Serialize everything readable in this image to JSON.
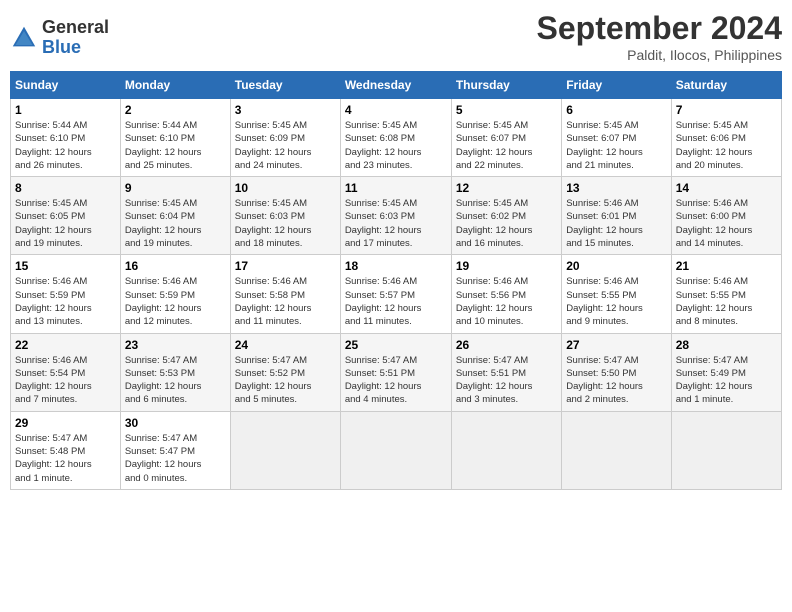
{
  "logo": {
    "general": "General",
    "blue": "Blue"
  },
  "title": {
    "month_year": "September 2024",
    "location": "Paldit, Ilocos, Philippines"
  },
  "weekdays": [
    "Sunday",
    "Monday",
    "Tuesday",
    "Wednesday",
    "Thursday",
    "Friday",
    "Saturday"
  ],
  "weeks": [
    [
      {
        "day": "1",
        "info": "Sunrise: 5:44 AM\nSunset: 6:10 PM\nDaylight: 12 hours\nand 26 minutes."
      },
      {
        "day": "2",
        "info": "Sunrise: 5:44 AM\nSunset: 6:10 PM\nDaylight: 12 hours\nand 25 minutes."
      },
      {
        "day": "3",
        "info": "Sunrise: 5:45 AM\nSunset: 6:09 PM\nDaylight: 12 hours\nand 24 minutes."
      },
      {
        "day": "4",
        "info": "Sunrise: 5:45 AM\nSunset: 6:08 PM\nDaylight: 12 hours\nand 23 minutes."
      },
      {
        "day": "5",
        "info": "Sunrise: 5:45 AM\nSunset: 6:07 PM\nDaylight: 12 hours\nand 22 minutes."
      },
      {
        "day": "6",
        "info": "Sunrise: 5:45 AM\nSunset: 6:07 PM\nDaylight: 12 hours\nand 21 minutes."
      },
      {
        "day": "7",
        "info": "Sunrise: 5:45 AM\nSunset: 6:06 PM\nDaylight: 12 hours\nand 20 minutes."
      }
    ],
    [
      {
        "day": "8",
        "info": "Sunrise: 5:45 AM\nSunset: 6:05 PM\nDaylight: 12 hours\nand 19 minutes."
      },
      {
        "day": "9",
        "info": "Sunrise: 5:45 AM\nSunset: 6:04 PM\nDaylight: 12 hours\nand 19 minutes."
      },
      {
        "day": "10",
        "info": "Sunrise: 5:45 AM\nSunset: 6:03 PM\nDaylight: 12 hours\nand 18 minutes."
      },
      {
        "day": "11",
        "info": "Sunrise: 5:45 AM\nSunset: 6:03 PM\nDaylight: 12 hours\nand 17 minutes."
      },
      {
        "day": "12",
        "info": "Sunrise: 5:45 AM\nSunset: 6:02 PM\nDaylight: 12 hours\nand 16 minutes."
      },
      {
        "day": "13",
        "info": "Sunrise: 5:46 AM\nSunset: 6:01 PM\nDaylight: 12 hours\nand 15 minutes."
      },
      {
        "day": "14",
        "info": "Sunrise: 5:46 AM\nSunset: 6:00 PM\nDaylight: 12 hours\nand 14 minutes."
      }
    ],
    [
      {
        "day": "15",
        "info": "Sunrise: 5:46 AM\nSunset: 5:59 PM\nDaylight: 12 hours\nand 13 minutes."
      },
      {
        "day": "16",
        "info": "Sunrise: 5:46 AM\nSunset: 5:59 PM\nDaylight: 12 hours\nand 12 minutes."
      },
      {
        "day": "17",
        "info": "Sunrise: 5:46 AM\nSunset: 5:58 PM\nDaylight: 12 hours\nand 11 minutes."
      },
      {
        "day": "18",
        "info": "Sunrise: 5:46 AM\nSunset: 5:57 PM\nDaylight: 12 hours\nand 11 minutes."
      },
      {
        "day": "19",
        "info": "Sunrise: 5:46 AM\nSunset: 5:56 PM\nDaylight: 12 hours\nand 10 minutes."
      },
      {
        "day": "20",
        "info": "Sunrise: 5:46 AM\nSunset: 5:55 PM\nDaylight: 12 hours\nand 9 minutes."
      },
      {
        "day": "21",
        "info": "Sunrise: 5:46 AM\nSunset: 5:55 PM\nDaylight: 12 hours\nand 8 minutes."
      }
    ],
    [
      {
        "day": "22",
        "info": "Sunrise: 5:46 AM\nSunset: 5:54 PM\nDaylight: 12 hours\nand 7 minutes."
      },
      {
        "day": "23",
        "info": "Sunrise: 5:47 AM\nSunset: 5:53 PM\nDaylight: 12 hours\nand 6 minutes."
      },
      {
        "day": "24",
        "info": "Sunrise: 5:47 AM\nSunset: 5:52 PM\nDaylight: 12 hours\nand 5 minutes."
      },
      {
        "day": "25",
        "info": "Sunrise: 5:47 AM\nSunset: 5:51 PM\nDaylight: 12 hours\nand 4 minutes."
      },
      {
        "day": "26",
        "info": "Sunrise: 5:47 AM\nSunset: 5:51 PM\nDaylight: 12 hours\nand 3 minutes."
      },
      {
        "day": "27",
        "info": "Sunrise: 5:47 AM\nSunset: 5:50 PM\nDaylight: 12 hours\nand 2 minutes."
      },
      {
        "day": "28",
        "info": "Sunrise: 5:47 AM\nSunset: 5:49 PM\nDaylight: 12 hours\nand 1 minute."
      }
    ],
    [
      {
        "day": "29",
        "info": "Sunrise: 5:47 AM\nSunset: 5:48 PM\nDaylight: 12 hours\nand 1 minute."
      },
      {
        "day": "30",
        "info": "Sunrise: 5:47 AM\nSunset: 5:47 PM\nDaylight: 12 hours\nand 0 minutes."
      },
      {
        "day": "",
        "info": ""
      },
      {
        "day": "",
        "info": ""
      },
      {
        "day": "",
        "info": ""
      },
      {
        "day": "",
        "info": ""
      },
      {
        "day": "",
        "info": ""
      }
    ]
  ]
}
